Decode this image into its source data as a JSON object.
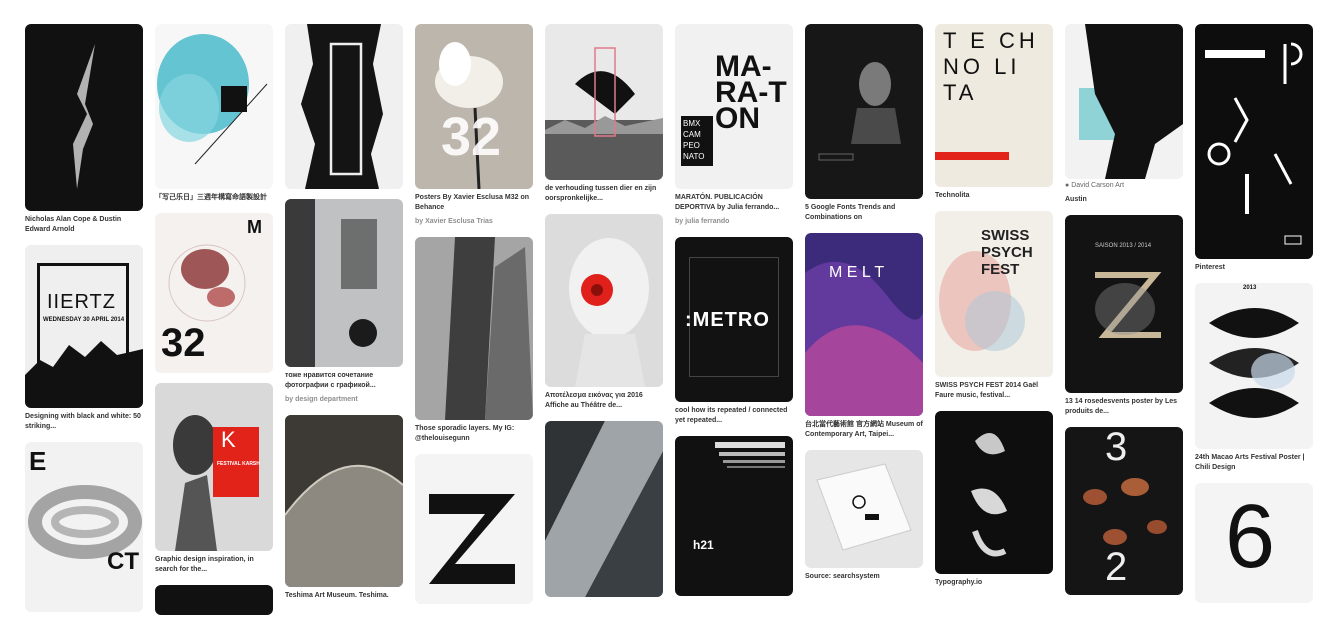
{
  "feed": {
    "pins": [
      {
        "caption": "Nicholas Alan Cope & Dustin Edward Arnold"
      },
      {
        "caption": "Designing with black and white: 50 striking...",
        "image_text": "IIERTZ",
        "image_subtext": "WEDNESDAY 30 APRIL 2014"
      },
      {
        "image_text": "E",
        "image_text_2": "CT"
      },
      {
        "caption": "「写己乐日」三週年構寫命語製設計"
      },
      {
        "image_text": "32",
        "image_text_2": "M"
      },
      {
        "caption": "Graphic design inspiration, in search for the...",
        "image_text": "K",
        "image_subtext": "FESTIVAL KARSH"
      },
      {},
      {
        "caption": "тоже нравится сочетание фотографии с графикой...",
        "sub": "by design department"
      },
      {
        "caption": "Teshima Art Museum. Teshima."
      },
      {
        "caption": "Posters By Xavier Esclusa M32 on Behance",
        "sub": "by Xavier Esclusa Trias",
        "image_text": "32"
      },
      {
        "caption": "Those sporadic layers. My IG: @thelouisegunn"
      },
      {},
      {
        "caption": "de verhouding tussen dier en zijn oorspronkelijke..."
      },
      {
        "caption": "Αποτέλεσμα εικόνας για 2016 Affiche au Théâtre de..."
      },
      {},
      {
        "caption": "MARATÓN. PUBLICACIÓN DEPORTIVA by Julia ferrando...",
        "sub": "by julia ferrando",
        "image_text": "MA-RA-TON",
        "image_subtext": "BMX CAM PEO NATO"
      },
      {
        "caption": "cool how its repeated / connected yet repeated...",
        "image_text": ":METRO"
      },
      {
        "image_text": "h21"
      },
      {
        "caption": "5 Google Fonts Trends and Combinations on"
      },
      {
        "caption": "台北當代藝術館 官方網站 Museum of Contemporary Art, Taipei...",
        "image_text": "M E L T"
      },
      {
        "caption": "Source: searchsystem"
      },
      {
        "caption": "Technolita",
        "image_text": "T E CH NO LI TA"
      },
      {
        "caption": "SWISS PSYCH FEST 2014 Gaël Faure music, festival...",
        "image_text": "SWISS PSYCH FEST"
      },
      {
        "caption": "Typography.io"
      },
      {
        "caption": "Austin",
        "source": "David Carson Art"
      },
      {
        "caption": "13 14 rosedesvents poster by Les produits de...",
        "image_text": "SAISON 2013 / 2014"
      },
      {
        "image_text": "3",
        "image_text_2": "2"
      },
      {
        "caption": "Pinterest"
      },
      {
        "caption": "24th Macao Arts Festival Poster | Chili Design",
        "image_text": "2013"
      },
      {
        "image_text": "6"
      }
    ]
  }
}
